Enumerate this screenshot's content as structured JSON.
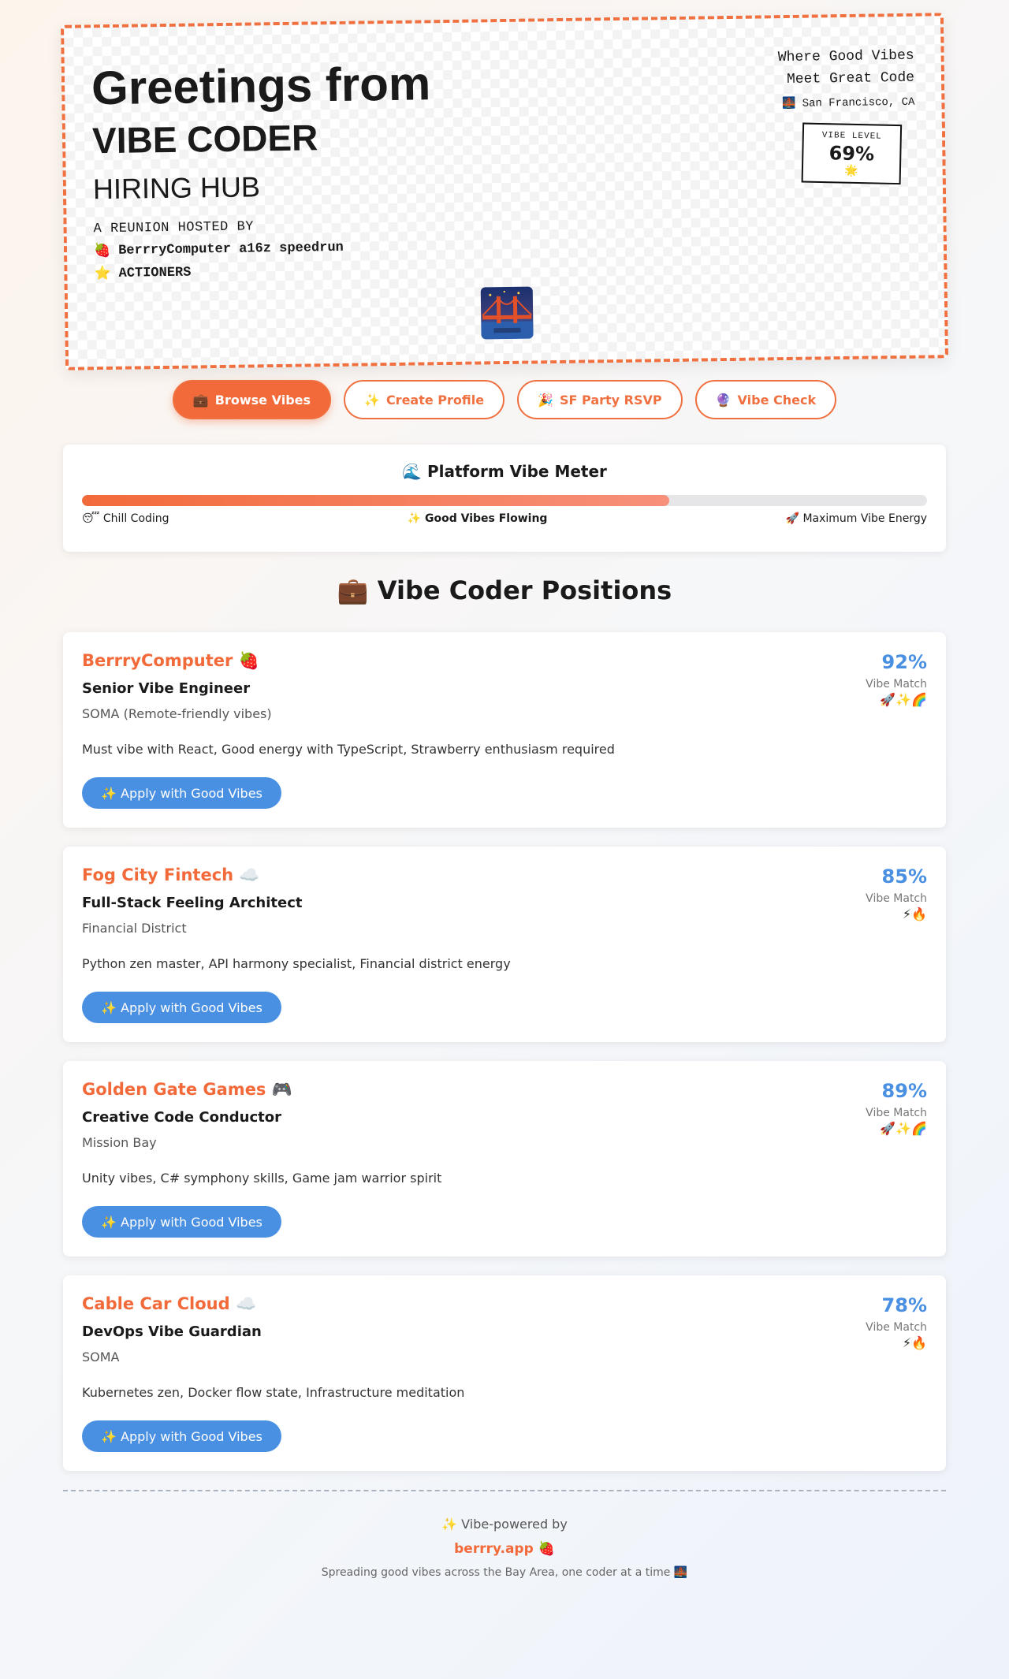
{
  "hero": {
    "title_line1": "Greetings from",
    "title_line2": "VIBE CODER",
    "title_line3": "HIRING HUB",
    "hosted_by": "A REUNION HOSTED BY",
    "hosts": [
      {
        "icon": "🍓",
        "label": "BerrryComputer a16z speedrun"
      },
      {
        "icon": "⭐",
        "label": "ACTIONERS"
      }
    ],
    "tagline_line1": "Where Good Vibes",
    "tagline_line2": "Meet Great Code",
    "location_icon": "🌉",
    "location": "San Francisco, CA",
    "stamp_label": "VIBE LEVEL",
    "stamp_value": "69%",
    "stamp_icon": "🌟"
  },
  "nav": [
    {
      "icon": "💼",
      "label": "Browse Vibes",
      "active": true
    },
    {
      "icon": "✨",
      "label": "Create Profile",
      "active": false
    },
    {
      "icon": "🎉",
      "label": "SF Party RSVP",
      "active": false
    },
    {
      "icon": "🔮",
      "label": "Vibe Check",
      "active": false
    }
  ],
  "meter": {
    "icon": "🌊",
    "title": "Platform Vibe Meter",
    "fill_fraction": 0.695,
    "label_left": "😴 Chill Coding",
    "label_mid": "✨ Good Vibes Flowing",
    "label_right": "🚀 Maximum Vibe Energy"
  },
  "positions_icon": "💼",
  "positions_title": "Vibe Coder Positions",
  "jobs": [
    {
      "company": "BerrryComputer 🍓",
      "role": "Senior Vibe Engineer",
      "location": "SOMA (Remote-friendly vibes)",
      "description": "Must vibe with React, Good energy with TypeScript, Strawberry enthusiasm required",
      "match": "92%",
      "match_label": "Vibe Match",
      "match_emoji": "🚀✨🌈",
      "apply": "✨ Apply with Good Vibes"
    },
    {
      "company": "Fog City Fintech ☁️",
      "role": "Full-Stack Feeling Architect",
      "location": "Financial District",
      "description": "Python zen master, API harmony specialist, Financial district energy",
      "match": "85%",
      "match_label": "Vibe Match",
      "match_emoji": "⚡🔥",
      "apply": "✨ Apply with Good Vibes"
    },
    {
      "company": "Golden Gate Games 🎮",
      "role": "Creative Code Conductor",
      "location": "Mission Bay",
      "description": "Unity vibes, C# symphony skills, Game jam warrior spirit",
      "match": "89%",
      "match_label": "Vibe Match",
      "match_emoji": "🚀✨🌈",
      "apply": "✨ Apply with Good Vibes"
    },
    {
      "company": "Cable Car Cloud ☁️",
      "role": "DevOps Vibe Guardian",
      "location": "SOMA",
      "description": "Kubernetes zen, Docker flow state, Infrastructure meditation",
      "match": "78%",
      "match_label": "Vibe Match",
      "match_emoji": "⚡🔥",
      "apply": "✨ Apply with Good Vibes"
    }
  ],
  "footer": {
    "line1": "✨ Vibe-powered by",
    "link": "berrry.app 🍓",
    "tagline": "Spreading good vibes across the Bay Area, one coder at a time 🌉"
  },
  "colors": {
    "accent": "#f26a3a",
    "match": "#4a90e2",
    "button": "#4a90e2"
  }
}
